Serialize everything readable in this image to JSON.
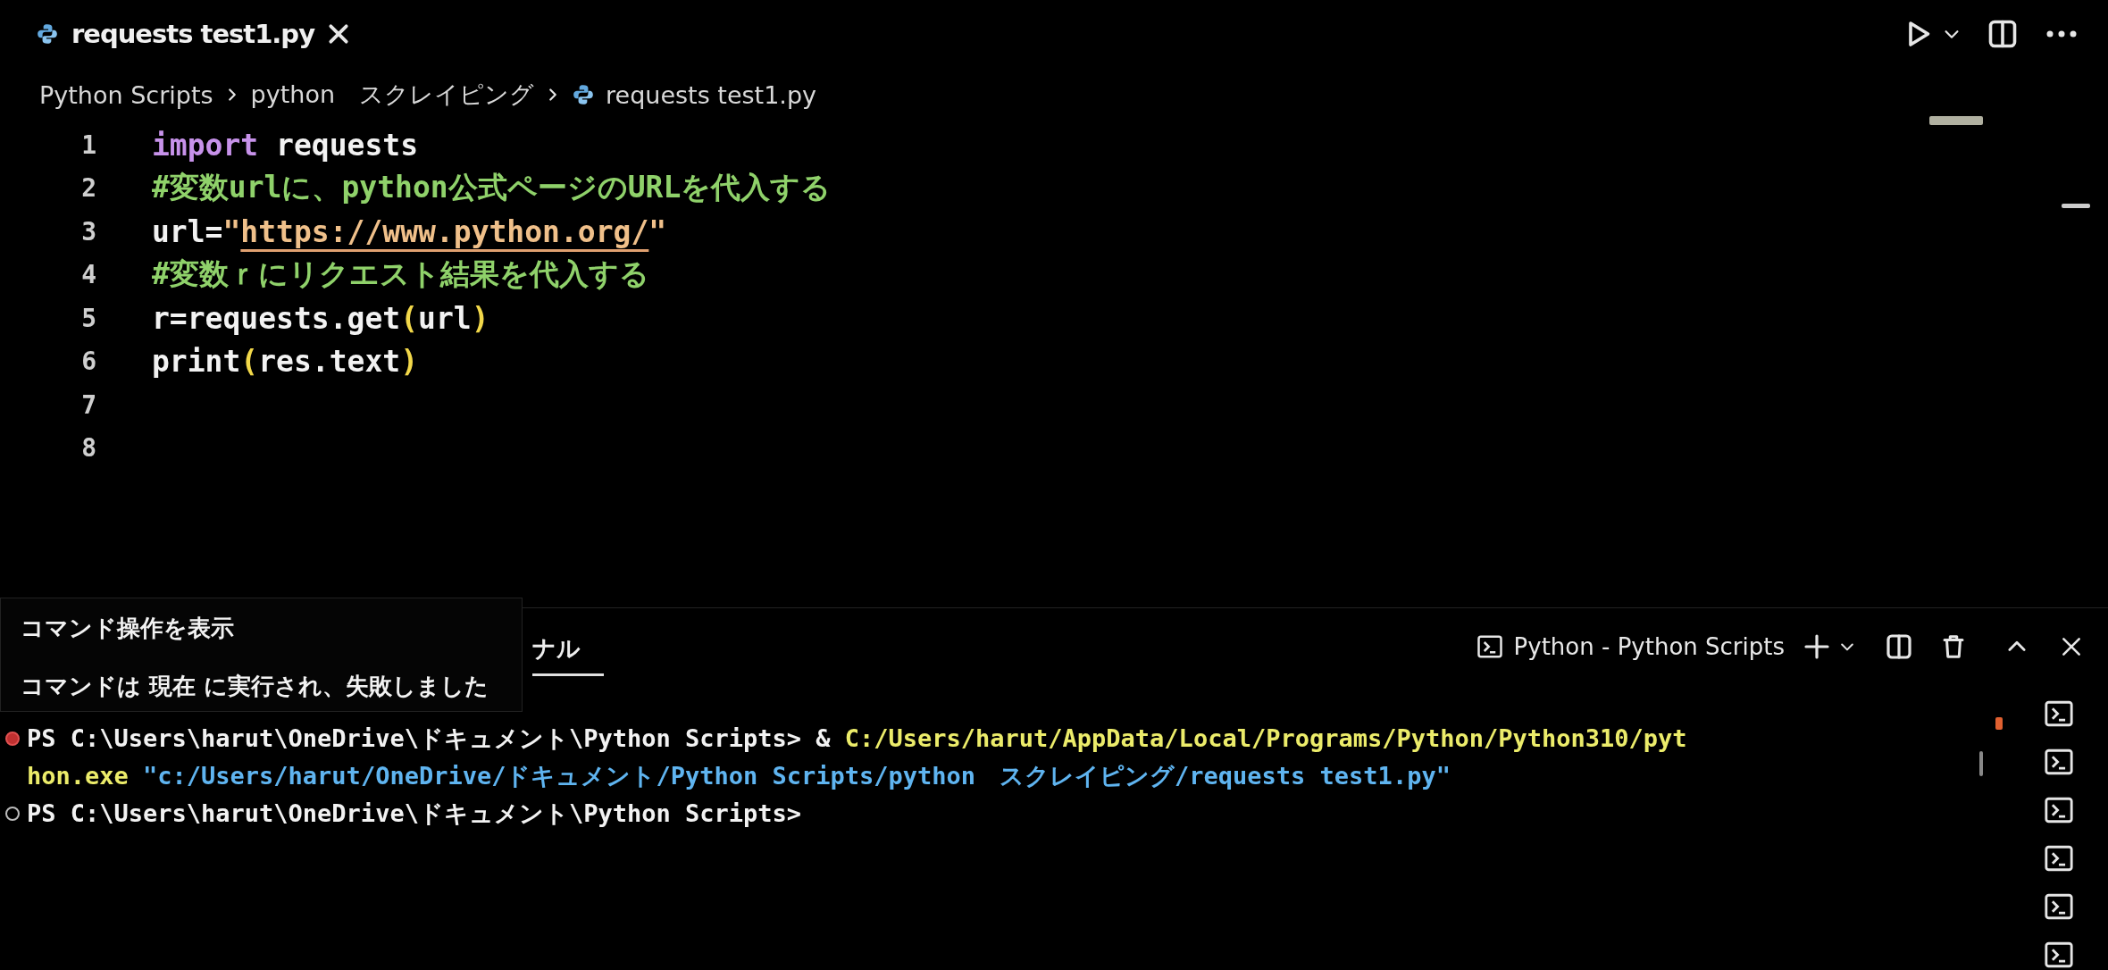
{
  "tabs": [
    {
      "label": "requests test1.py",
      "selected": true
    }
  ],
  "breadcrumb": [
    "Python Scripts",
    "python　スクレイピング",
    "requests test1.py"
  ],
  "code": [
    {
      "number": "1",
      "tokens": [
        {
          "kind": "keyword",
          "text": "import"
        },
        {
          "kind": "plain",
          "text": " requests"
        }
      ]
    },
    {
      "number": "2",
      "tokens": [
        {
          "kind": "comment",
          "text": "#変数urlに、python公式ページのURLを代入する"
        }
      ]
    },
    {
      "number": "3",
      "tokens": [
        {
          "kind": "plain",
          "text": "url="
        },
        {
          "kind": "string",
          "text": "\""
        },
        {
          "kind": "link",
          "text": "https://www.python.org/"
        },
        {
          "kind": "string",
          "text": "\""
        }
      ]
    },
    {
      "number": "4",
      "tokens": [
        {
          "kind": "comment",
          "text": "#変数ｒにリクエスト結果を代入する"
        }
      ]
    },
    {
      "number": "5",
      "tokens": [
        {
          "kind": "plain",
          "text": "r=requests.get"
        },
        {
          "kind": "paren",
          "text": "("
        },
        {
          "kind": "plain",
          "text": "url"
        },
        {
          "kind": "paren",
          "text": ")"
        }
      ]
    },
    {
      "number": "6",
      "tokens": [
        {
          "kind": "plain",
          "text": "print"
        },
        {
          "kind": "paren",
          "text": "("
        },
        {
          "kind": "plain",
          "text": "res.text"
        },
        {
          "kind": "paren",
          "text": ")"
        }
      ]
    },
    {
      "number": "7"
    },
    {
      "number": "8"
    }
  ],
  "panel": {
    "tabs": [
      {
        "label": "ナル",
        "selected": true
      }
    ],
    "terminal_name": "Python - Python Scripts",
    "lines": [
      {
        "decorated": true,
        "failed": true,
        "segments": [
          {
            "kind": "prompt",
            "text": "PS C:\\Users\\harut\\OneDrive\\ドキュメント\\Python Scripts> & "
          },
          {
            "kind": "path",
            "text": "C:/Users/harut/AppData/Local/Programs/Python/Python310/pyt"
          }
        ]
      },
      {
        "decorated": false,
        "segments": [
          {
            "kind": "path",
            "text": "hon.exe "
          },
          {
            "kind": "string",
            "text": "\"c:/Users/harut/OneDrive/ドキュメント/Python Scripts/python　スクレイピング/requests test1.py\""
          }
        ]
      },
      {
        "decorated": true,
        "failed": false,
        "segments": [
          {
            "kind": "prompt",
            "text": "PS C:\\Users\\harut\\OneDrive\\ドキュメント\\Python Scripts>"
          }
        ]
      }
    ]
  },
  "tooltip": {
    "title": "コマンド操作を表示",
    "message": "コマンドは 現在 に実行され、失敗しました"
  }
}
